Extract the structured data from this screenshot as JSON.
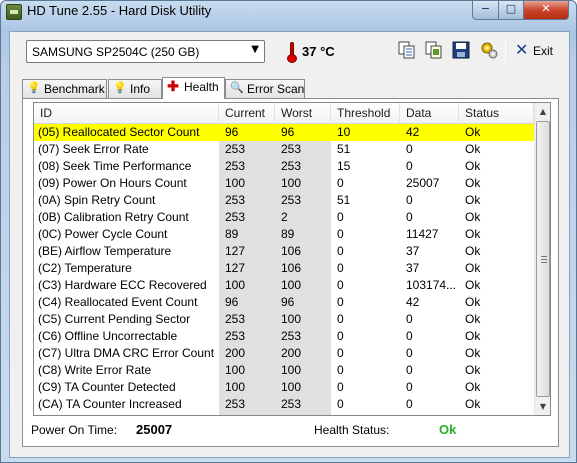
{
  "window": {
    "title": "HD Tune 2.55 - Hard Disk Utility",
    "controls": {
      "minimize": "−",
      "maximize": "□",
      "close": "✕"
    }
  },
  "toolbar": {
    "drive": "SAMSUNG SP2504C (250 GB)",
    "temperature": "37 °C",
    "exit_label": "Exit",
    "icons": [
      "copy-text-icon",
      "copy-screenshot-icon",
      "save-icon",
      "options-icon",
      "exit-icon"
    ]
  },
  "tabs": [
    {
      "label": "Benchmark",
      "icon": "lightbulb-icon"
    },
    {
      "label": "Info",
      "icon": "lightbulb-icon"
    },
    {
      "label": "Health",
      "icon": "health-cross-icon",
      "active": true
    },
    {
      "label": "Error Scan",
      "icon": "magnifier-icon"
    }
  ],
  "table": {
    "headers": [
      "ID",
      "Current",
      "Worst",
      "Threshold",
      "Data",
      "Status"
    ],
    "rows": [
      {
        "id": "(05) Reallocated Sector Count",
        "current": "96",
        "worst": "96",
        "threshold": "10",
        "data": "42",
        "status": "Ok",
        "selected": true
      },
      {
        "id": "(07) Seek Error Rate",
        "current": "253",
        "worst": "253",
        "threshold": "51",
        "data": "0",
        "status": "Ok"
      },
      {
        "id": "(08) Seek Time Performance",
        "current": "253",
        "worst": "253",
        "threshold": "15",
        "data": "0",
        "status": "Ok"
      },
      {
        "id": "(09) Power On Hours Count",
        "current": "100",
        "worst": "100",
        "threshold": "0",
        "data": "25007",
        "status": "Ok"
      },
      {
        "id": "(0A) Spin Retry Count",
        "current": "253",
        "worst": "253",
        "threshold": "51",
        "data": "0",
        "status": "Ok"
      },
      {
        "id": "(0B) Calibration Retry Count",
        "current": "253",
        "worst": "2",
        "threshold": "0",
        "data": "0",
        "status": "Ok"
      },
      {
        "id": "(0C) Power Cycle Count",
        "current": "89",
        "worst": "89",
        "threshold": "0",
        "data": "11427",
        "status": "Ok"
      },
      {
        "id": "(BE) Airflow Temperature",
        "current": "127",
        "worst": "106",
        "threshold": "0",
        "data": "37",
        "status": "Ok"
      },
      {
        "id": "(C2) Temperature",
        "current": "127",
        "worst": "106",
        "threshold": "0",
        "data": "37",
        "status": "Ok"
      },
      {
        "id": "(C3) Hardware ECC Recovered",
        "current": "100",
        "worst": "100",
        "threshold": "0",
        "data": "103174...",
        "status": "Ok"
      },
      {
        "id": "(C4) Reallocated Event Count",
        "current": "96",
        "worst": "96",
        "threshold": "0",
        "data": "42",
        "status": "Ok"
      },
      {
        "id": "(C5) Current Pending Sector",
        "current": "253",
        "worst": "100",
        "threshold": "0",
        "data": "0",
        "status": "Ok"
      },
      {
        "id": "(C6) Offline Uncorrectable",
        "current": "253",
        "worst": "253",
        "threshold": "0",
        "data": "0",
        "status": "Ok"
      },
      {
        "id": "(C7) Ultra DMA CRC Error Count",
        "current": "200",
        "worst": "200",
        "threshold": "0",
        "data": "0",
        "status": "Ok"
      },
      {
        "id": "(C8) Write Error Rate",
        "current": "100",
        "worst": "100",
        "threshold": "0",
        "data": "0",
        "status": "Ok"
      },
      {
        "id": "(C9) TA Counter Detected",
        "current": "100",
        "worst": "100",
        "threshold": "0",
        "data": "0",
        "status": "Ok"
      },
      {
        "id": "(CA) TA Counter Increased",
        "current": "253",
        "worst": "253",
        "threshold": "0",
        "data": "0",
        "status": "Ok"
      }
    ]
  },
  "footer": {
    "power_on_label": "Power On Time:",
    "power_on_value": "25007",
    "health_label": "Health Status:",
    "health_value": "Ok"
  },
  "colors": {
    "selected_row": "#ffff00",
    "health_ok": "#22b222",
    "thermometer": "#d00000"
  }
}
